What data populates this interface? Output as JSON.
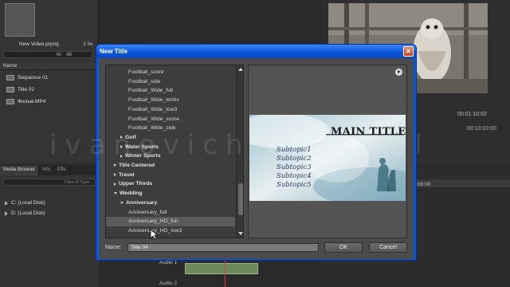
{
  "project": {
    "name": "New Video.prproj",
    "count": "3 Ite",
    "in_label": "In:",
    "in_value": "All",
    "column_name": "Name",
    "items": [
      {
        "label": "Sequence 01",
        "icon": "sequence-icon"
      },
      {
        "label": "Title 02",
        "icon": "title-icon"
      },
      {
        "label": "Фильм.MP4",
        "icon": "video-file-icon"
      }
    ]
  },
  "media_browser": {
    "tabs": [
      "Media Browser",
      "Info",
      "Effe"
    ],
    "files_label": "Files of Type:",
    "disks": [
      "C: (Local Disk)",
      "D: (Local Disk)"
    ]
  },
  "program_monitor": {
    "timecode": "00:01:10:02",
    "timeline_tc": "00:10:00:00",
    "seq_tc": "00:04:00:00"
  },
  "timeline": {
    "tracks": [
      "Audio 1",
      "Audio 2"
    ]
  },
  "dialog": {
    "title": "New Title",
    "close_glyph": "✕",
    "tree": [
      {
        "label": "Football_score",
        "level": 2,
        "kind": "item"
      },
      {
        "label": "Football_side",
        "level": 2,
        "kind": "item"
      },
      {
        "label": "Football_Wide_full",
        "level": 2,
        "kind": "item"
      },
      {
        "label": "Football_Wide_letrbx",
        "level": 2,
        "kind": "item"
      },
      {
        "label": "Football_Wide_low3",
        "level": 2,
        "kind": "item"
      },
      {
        "label": "Football_Wide_score",
        "level": 2,
        "kind": "item"
      },
      {
        "label": "Football_Wide_side",
        "level": 2,
        "kind": "item"
      },
      {
        "label": "Golf",
        "level": 1,
        "kind": "collapsed"
      },
      {
        "label": "Water Sports",
        "level": 1,
        "kind": "collapsed"
      },
      {
        "label": "Winter Sports",
        "level": 1,
        "kind": "collapsed"
      },
      {
        "label": "Title Centered",
        "level": 0,
        "kind": "collapsed"
      },
      {
        "label": "Travel",
        "level": 0,
        "kind": "collapsed"
      },
      {
        "label": "Upper Thirds",
        "level": 0,
        "kind": "collapsed"
      },
      {
        "label": "Wedding",
        "level": 0,
        "kind": "expanded"
      },
      {
        "label": "Anniversary",
        "level": 1,
        "kind": "expanded"
      },
      {
        "label": "Anniversary_full",
        "level": 2,
        "kind": "item"
      },
      {
        "label": "Anniversary_HD_full",
        "level": 2,
        "kind": "selected"
      },
      {
        "label": "Anniversary_HD_low3",
        "level": 2,
        "kind": "item"
      }
    ],
    "preview": {
      "main_title": "MAIN TITLE",
      "subtopics": [
        "Subtopic1",
        "Subtopic2",
        "Subtopic3",
        "Subtopic4",
        "Subtopic5"
      ]
    },
    "name_label": "Name:",
    "name_value": "Title 04",
    "ok_label": "OK",
    "cancel_label": "Cancel"
  },
  "watermark": "ivanovich channel",
  "colors": {
    "xp_titlebar": "#0a54d8",
    "dialog_body": "#4b4b4b",
    "close_button": "#c8432a"
  }
}
